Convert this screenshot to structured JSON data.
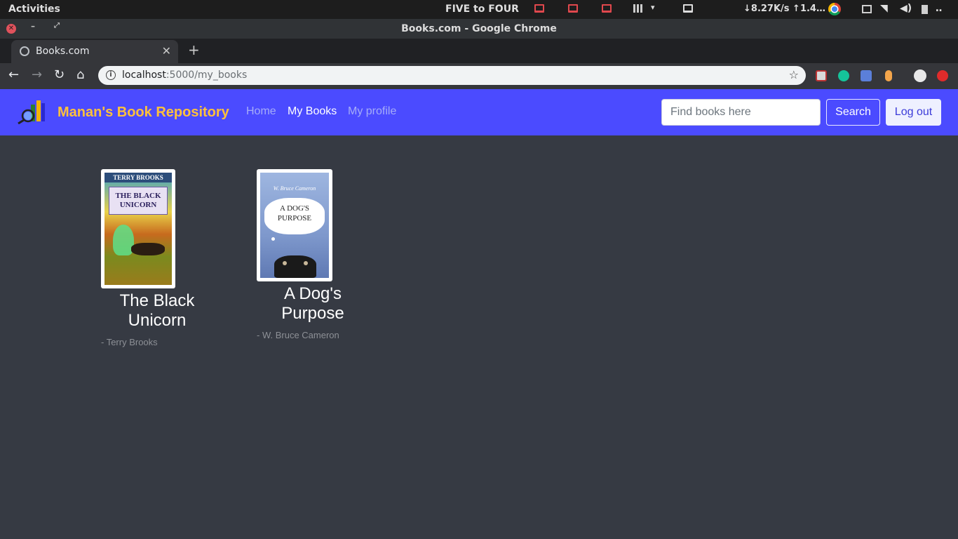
{
  "os": {
    "activities": "Activities",
    "clock_label": "FIVE to FOUR",
    "net_speed": "↓8.27K/s ↑1.4…",
    "overflow": "‥"
  },
  "window": {
    "title": "Books.com - Google Chrome"
  },
  "browser": {
    "tab_title": "Books.com",
    "url_host": "localhost",
    "url_path": ":5000/my_books"
  },
  "navbar": {
    "brand": "Manan's Book Repository",
    "links": [
      {
        "label": "Home",
        "active": false
      },
      {
        "label": "My Books",
        "active": true
      },
      {
        "label": "My profile",
        "active": false
      }
    ],
    "search_placeholder": "Find books here",
    "search_button": "Search",
    "logout_button": "Log out",
    "color": "#4b4bff",
    "brand_color": "#ffc13b"
  },
  "books": [
    {
      "title": "The Black Unicorn",
      "author": "- Terry Brooks",
      "cover_text_top": "TERRY BROOKS",
      "cover_text_main": "THE BLACK UNICORN"
    },
    {
      "title": "A Dog's Purpose",
      "author": "- W. Bruce Cameron",
      "cover_text_top": "W. Bruce Cameron",
      "cover_text_main": "A DOG'S PURPOSE"
    }
  ],
  "page_bg": "#363a43"
}
